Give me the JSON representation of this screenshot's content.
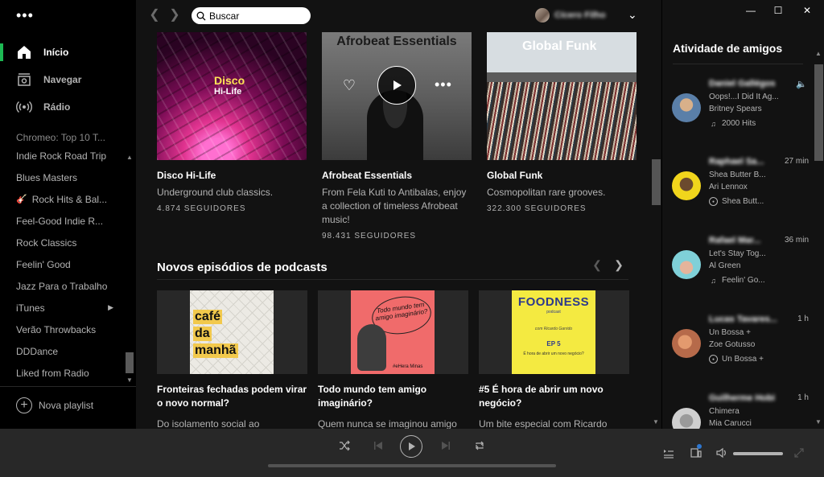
{
  "sidebar": {
    "menu_icon": "more-dots-icon",
    "nav": [
      {
        "label": "Início",
        "icon": "home-icon",
        "active": true
      },
      {
        "label": "Navegar",
        "icon": "browse-icon",
        "active": false
      },
      {
        "label": "Rádio",
        "icon": "radio-icon",
        "active": false
      }
    ],
    "playlists": [
      "Chromeo: Top 10 T...",
      "Indie Rock Road Trip",
      "Blues Masters",
      "Rock Hits & Bal...",
      "Feel-Good Indie R...",
      "Rock Classics",
      "Feelin' Good",
      "Jazz Para o Trabalho",
      "iTunes",
      "Verão Throwbacks",
      "DDDance",
      "Liked from Radio"
    ],
    "new_playlist": "Nova playlist"
  },
  "topbar": {
    "search_placeholder": "Buscar",
    "user_name": "Cícero Filho"
  },
  "cards": [
    {
      "art_title": "Disco",
      "art_subtitle": "Hi-Life",
      "title": "Disco Hi-Life",
      "desc": "Underground club classics.",
      "followers": "4.874 SEGUIDORES"
    },
    {
      "art_title": "Afrobeat Essentials",
      "title": "Afrobeat Essentials",
      "desc": "From Fela Kuti to Antibalas, enjoy a collection of timeless Afrobeat music!",
      "followers": "98.431 SEGUIDORES"
    },
    {
      "art_title": "Global Funk",
      "title": "Global Funk",
      "desc": "Cosmopolitan rare grooves.",
      "followers": "322.300 SEGUIDORES"
    }
  ],
  "podcasts": {
    "section_title": "Novos episódios de podcasts",
    "items": [
      {
        "cover_lines": [
          "café",
          "da",
          "manhã"
        ],
        "title": "Fronteiras fechadas podem virar o novo normal?",
        "desc": "Do isolamento social ao"
      },
      {
        "cover_text": "Todo mundo tem amigo imaginário?",
        "cover_sig": "#eHera Minas",
        "title": "Todo mundo tem amigo imaginário?",
        "desc": "Quem nunca se imaginou amigo"
      },
      {
        "cover_title": "FOODNESS",
        "cover_sub": "podcast",
        "cover_by": "com Ricardo Garrido",
        "cover_ep": "EP 5",
        "cover_q": "É hora de abrir um novo negócio?",
        "title": "#5 É hora de abrir um novo negócio?",
        "desc": "Um bite especial com Ricardo"
      }
    ]
  },
  "friends": {
    "title": "Atividade de amigos",
    "items": [
      {
        "name": "Daniel Gallégos",
        "time": "",
        "playing": true,
        "track": "Oops!...I Did It Ag...",
        "artist": "Britney Spears",
        "context": "2000 Hits",
        "context_icon": "music-note-icon",
        "avatar_color": "#5a7fa8"
      },
      {
        "name": "Raphael Sa...",
        "time": "27 min",
        "playing": false,
        "track": "Shea Butter B...",
        "artist": "Ari Lennox",
        "context": "Shea Butt...",
        "context_icon": "album-icon",
        "avatar_color": "#f1d51c"
      },
      {
        "name": "Rafael Mar...",
        "time": "36 min",
        "playing": false,
        "track": "Let's Stay Tog...",
        "artist": "Al Green",
        "context": "Feelin' Go...",
        "context_icon": "music-note-icon",
        "avatar_color": "#7fd0d8"
      },
      {
        "name": "Lucas Tavares...",
        "time": "1 h",
        "playing": false,
        "track": "Un Bossa +",
        "artist": "Zoe Gotusso",
        "context": "Un Bossa +",
        "context_icon": "album-icon",
        "avatar_color": "#b66a4a"
      },
      {
        "name": "Guilherme Hobi",
        "time": "1 h",
        "playing": false,
        "track": "Chimera",
        "artist": "Mia Carucci",
        "context": "",
        "context_icon": "",
        "avatar_color": "#cfcfcf"
      }
    ]
  },
  "window": {
    "minimize": "—",
    "maximize": "☐",
    "close": "✕"
  },
  "player": {
    "progress": 0.0,
    "volume": 1.0
  }
}
